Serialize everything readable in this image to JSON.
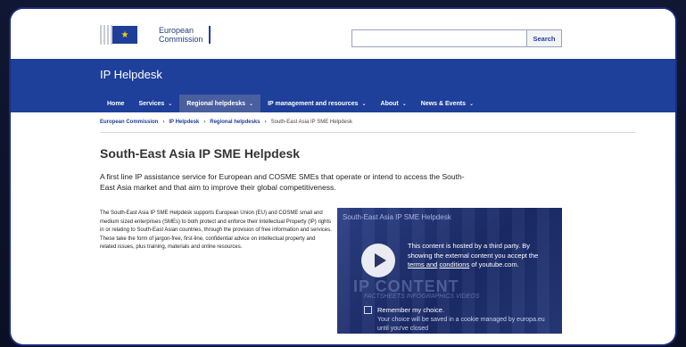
{
  "header": {
    "logo_line1": "European",
    "logo_line2": "Commission",
    "search_placeholder": "",
    "search_button": "Search"
  },
  "band": {
    "title": "IP Helpdesk"
  },
  "nav": [
    {
      "label": "Home",
      "has_menu": false,
      "active": false
    },
    {
      "label": "Services",
      "has_menu": true,
      "active": false
    },
    {
      "label": "Regional helpdesks",
      "has_menu": true,
      "active": true
    },
    {
      "label": "IP management and resources",
      "has_menu": true,
      "active": false
    },
    {
      "label": "About",
      "has_menu": true,
      "active": false
    },
    {
      "label": "News & Events",
      "has_menu": true,
      "active": false
    }
  ],
  "breadcrumb": {
    "items": [
      "European Commission",
      "IP Helpdesk",
      "Regional helpdesks"
    ],
    "current": "South-East Asia IP SME Helpdesk"
  },
  "page": {
    "title": "South-East Asia IP SME Helpdesk",
    "lead": "A first line IP assistance service for European and COSME SMEs that operate or intend to access the South-East Asia market and that aim to improve their global competitiveness.",
    "body": "The South-East Asia IP SME Helpdesk supports European Union (EU) and COSME small and medium sized enterprises (SMEs) to both protect and enforce their Intellectual Property (IP) rights in or relating to South-East Asian countries, through the provision of free information and services. These take the form of jargon-free, first-line, confidential advice on intellectual property and related issues, plus training, materials and online resources."
  },
  "video": {
    "title": "South-East Asia IP SME Helpdesk",
    "bg_word": "IP CONTENT",
    "bg_word2": "FACTSHEETS  INFOGRAPHICS  VIDEOS",
    "notice_pre": "This content is hosted by a third party. By showing the external content you accept the ",
    "notice_link1": "terms and",
    "notice_link2": "conditions",
    "notice_post": " of youtube.com.",
    "remember": "Remember my choice.",
    "choice": "Your choice will be saved in a cookie managed by europa.eu until you've closed"
  },
  "colors": {
    "brand_blue": "#1e3f9a",
    "active_nav": "#4a5f9e"
  }
}
